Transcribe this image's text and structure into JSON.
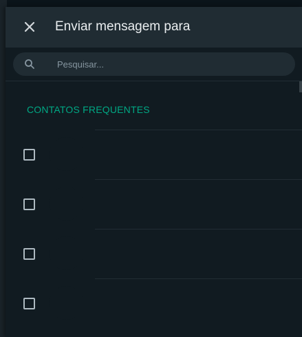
{
  "header": {
    "title": "Enviar mensagem para",
    "close_icon": "close-icon"
  },
  "search": {
    "placeholder": "Pesquisar...",
    "value": "",
    "icon": "search-icon"
  },
  "section": {
    "title": "CONTATOS FREQUENTES"
  },
  "contacts": [
    {
      "name": "",
      "checked": false
    },
    {
      "name": "",
      "checked": false
    },
    {
      "name": "",
      "checked": false
    },
    {
      "name": "",
      "checked": false
    }
  ],
  "colors": {
    "accent": "#00a884",
    "background": "#111b21",
    "header": "#202c33",
    "text": "#e9edef",
    "muted": "#8696a0"
  }
}
